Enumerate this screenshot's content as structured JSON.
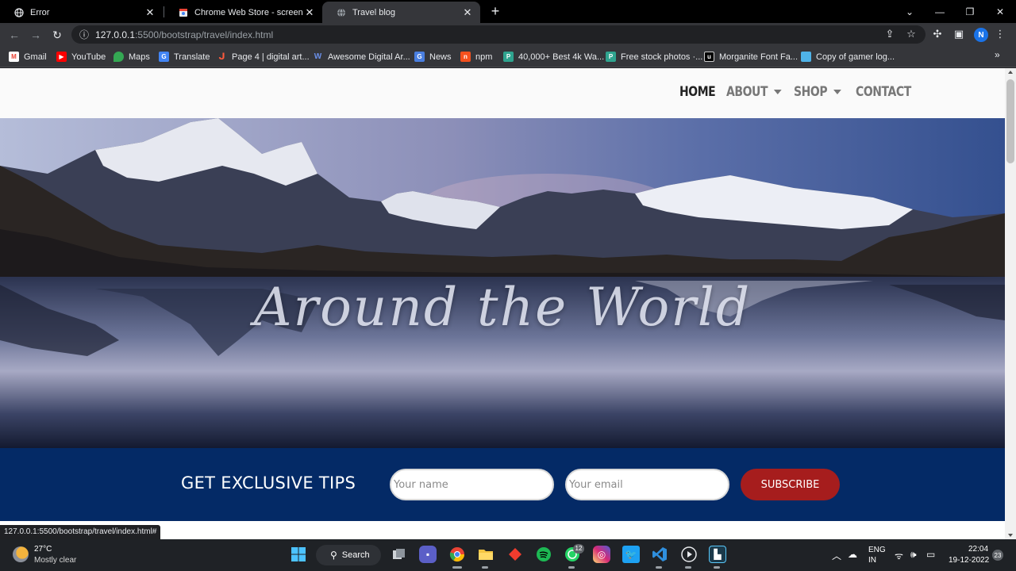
{
  "browser": {
    "tabs": [
      {
        "title": "Error"
      },
      {
        "title": "Chrome Web Store - screen recor"
      },
      {
        "title": "Travel blog"
      }
    ],
    "url_host": "127.0.0.1",
    "url_path": ":5500/bootstrap/travel/index.html",
    "profile_initial": "N",
    "bookmarks": [
      {
        "label": "Gmail"
      },
      {
        "label": "YouTube"
      },
      {
        "label": "Maps"
      },
      {
        "label": "Translate"
      },
      {
        "label": "Page 4 | digital art..."
      },
      {
        "label": "Awesome Digital Ar..."
      },
      {
        "label": "News"
      },
      {
        "label": "npm"
      },
      {
        "label": "40,000+ Best 4k Wa..."
      },
      {
        "label": "Free stock photos ·..."
      },
      {
        "label": "Morganite Font Fa..."
      },
      {
        "label": "Copy of gamer log..."
      }
    ],
    "status_url": "127.0.0.1:5500/bootstrap/travel/index.html#"
  },
  "site": {
    "nav": {
      "home": "HOME",
      "about": "ABOUT",
      "shop": "SHOP",
      "contact": "CONTACT"
    },
    "hero": {
      "title": "Around the World"
    },
    "tips": {
      "heading": "GET EXCLUSIVE TIPS",
      "name_placeholder": "Your name",
      "email_placeholder": "Your email",
      "subscribe_label": "SUBSCRIBE"
    }
  },
  "taskbar": {
    "weather_temp": "27°C",
    "weather_desc": "Mostly clear",
    "search_label": "Search",
    "whatsapp_badge": "12",
    "lang_line1": "ENG",
    "lang_line2": "IN",
    "time": "22:04",
    "date": "19-12-2022",
    "notification_count": "23"
  },
  "colors": {
    "tips_band": "#042a66",
    "subscribe": "#a61d1d",
    "nav_active": "#222222",
    "nav_inactive": "#777777"
  }
}
